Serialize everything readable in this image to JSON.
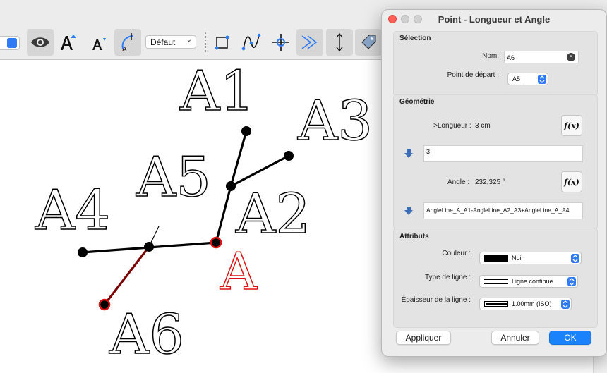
{
  "toolbar": {
    "style_select_value": "Défaut",
    "buttons": [
      "eye-icon",
      "text-size-increase-icon",
      "text-size-decrease-icon",
      "label-tool-icon",
      "point-on-object-icon",
      "spline-icon",
      "intersection-icon",
      "ray-icon",
      "vertical-arrow-icon",
      "tag-settings-icon"
    ]
  },
  "canvas": {
    "labels": {
      "a1": "A1",
      "a2": "A2",
      "a3": "A3",
      "a4": "A4",
      "a5": "A5",
      "a6": "A6",
      "a": "A"
    },
    "colors": {
      "line": "#000000",
      "selected_point": "#e01010",
      "highlight_segment": "#7a0000"
    }
  },
  "dialog": {
    "title": "Point - Longueur et Angle",
    "selection": {
      "heading": "Sélection",
      "name_label": "Nom:",
      "name_value": "A6",
      "start_point_label": "Point de départ :",
      "start_point_value": "A5"
    },
    "geometry": {
      "heading": "Géométrie",
      "length_label": ">Longueur :",
      "length_value": "3 cm",
      "length_formula": "3",
      "angle_label": "Angle :",
      "angle_value": "232,325 °",
      "angle_formula": "AngleLine_A_A1-AngleLine_A2_A3+AngleLine_A_A4",
      "fx_label": "f(x)"
    },
    "attributes": {
      "heading": "Attributs",
      "color_label": "Couleur :",
      "color_value": "Noir",
      "line_type_label": "Type de ligne :",
      "line_type_value": "Ligne continue",
      "thickness_label": "Épaisseur de la ligne :",
      "thickness_value": "1.00mm (ISO)"
    },
    "buttons": {
      "apply": "Appliquer",
      "cancel": "Annuler",
      "ok": "OK"
    }
  }
}
